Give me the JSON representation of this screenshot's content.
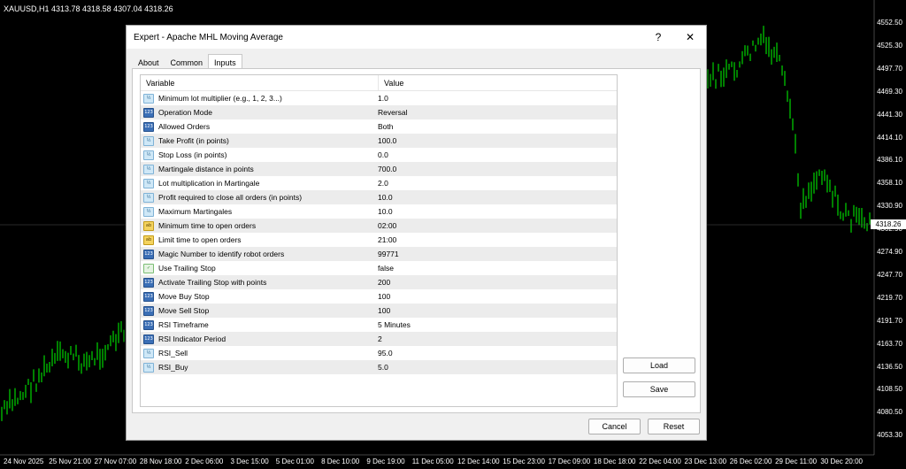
{
  "chart": {
    "symbol": "XAUUSD,H1  4313.78 4318.58 4307.04 4318.26",
    "price_labels": [
      "4552.50",
      "4525.30",
      "4497.70",
      "4469.30",
      "4441.30",
      "4414.10",
      "4386.10",
      "4358.10",
      "4330.90",
      "4302.90",
      "4274.90",
      "4247.70",
      "4219.70",
      "4191.70",
      "4163.70",
      "4136.50",
      "4108.50",
      "4080.50",
      "4053.30"
    ],
    "current_price": "4318.26",
    "date_labels": [
      "24 Nov 2025",
      "25 Nov 21:00",
      "27 Nov 07:00",
      "28 Nov 18:00",
      "2 Dec 06:00",
      "3 Dec 15:00",
      "5 Dec 01:00",
      "8 Dec 10:00",
      "9 Dec 19:00",
      "11 Dec 05:00",
      "12 Dec 14:00",
      "15 Dec 23:00",
      "17 Dec 09:00",
      "18 Dec 18:00",
      "22 Dec 04:00",
      "23 Dec 13:00",
      "26 Dec 02:00",
      "29 Dec 11:00",
      "30 Dec 20:00"
    ],
    "candle_color": "#00ff00"
  },
  "dialog": {
    "title": "Expert - Apache MHL Moving Average",
    "help": "?",
    "close": "✕",
    "tabs": [
      "About",
      "Common",
      "Inputs"
    ],
    "active_tab": "Inputs",
    "headers": {
      "variable": "Variable",
      "value": "Value"
    },
    "params": [
      {
        "icon": "frac",
        "label": "Minimum lot multiplier (e.g., 1, 2, 3...)",
        "value": "1.0"
      },
      {
        "icon": "num",
        "label": "Operation Mode",
        "value": "Reversal"
      },
      {
        "icon": "num",
        "label": "Allowed Orders",
        "value": "Both"
      },
      {
        "icon": "frac",
        "label": "Take Profit (in points)",
        "value": "100.0"
      },
      {
        "icon": "frac",
        "label": "Stop Loss (in points)",
        "value": "0.0"
      },
      {
        "icon": "frac",
        "label": "Martingale distance in points",
        "value": "700.0"
      },
      {
        "icon": "frac",
        "label": "Lot multiplication in Martingale",
        "value": "2.0"
      },
      {
        "icon": "frac",
        "label": "Profit required to close all orders (in points)",
        "value": "10.0"
      },
      {
        "icon": "frac",
        "label": "Maximum Martingales",
        "value": "10.0"
      },
      {
        "icon": "str",
        "label": "Minimum time to open orders",
        "value": "02:00"
      },
      {
        "icon": "str",
        "label": "Limit time to open orders",
        "value": "21:00"
      },
      {
        "icon": "num",
        "label": "Magic Number to identify robot orders",
        "value": "99771"
      },
      {
        "icon": "bool",
        "label": "Use Trailing Stop",
        "value": "false"
      },
      {
        "icon": "num",
        "label": "Activate Trailing Stop with points",
        "value": "200"
      },
      {
        "icon": "num",
        "label": "Move Buy Stop",
        "value": "100"
      },
      {
        "icon": "num",
        "label": "Move Sell Stop",
        "value": "100"
      },
      {
        "icon": "num",
        "label": "RSI Timeframe",
        "value": "5 Minutes"
      },
      {
        "icon": "num",
        "label": "RSI Indicator Period",
        "value": "2"
      },
      {
        "icon": "frac",
        "label": "RSI_Sell",
        "value": "95.0"
      },
      {
        "icon": "frac",
        "label": "RSI_Buy",
        "value": "5.0"
      }
    ],
    "buttons": {
      "load": "Load",
      "save": "Save",
      "cancel": "Cancel",
      "reset": "Reset"
    }
  }
}
